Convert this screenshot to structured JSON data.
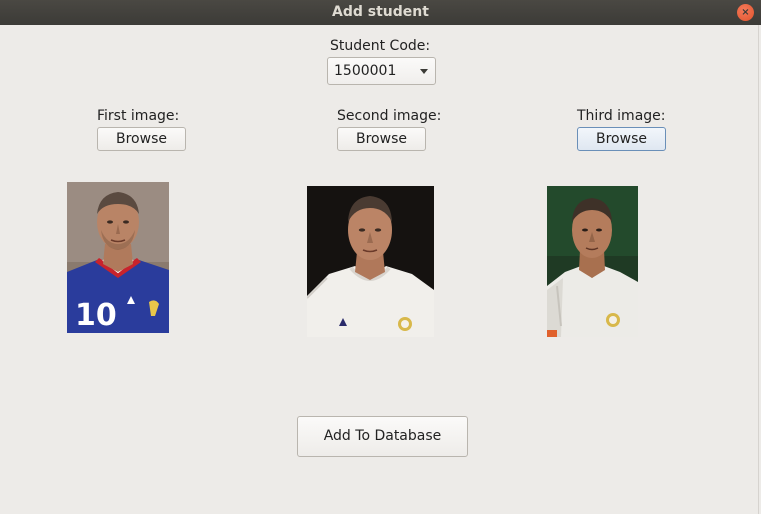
{
  "window": {
    "title": "Add student",
    "close_glyph": "×"
  },
  "student_code": {
    "label": "Student Code:",
    "selected": "1500001"
  },
  "images": [
    {
      "label": "First image:",
      "browse_label": "Browse",
      "icon": "photo-player-blue-jersey-10"
    },
    {
      "label": "Second image:",
      "browse_label": "Browse",
      "icon": "photo-player-white-jersey"
    },
    {
      "label": "Third image:",
      "browse_label": "Browse",
      "icon": "photo-player-white-jersey-green-bg"
    }
  ],
  "photo_number": "10",
  "add_button_label": "Add To Database",
  "colors": {
    "titlebar": "#3c3b37",
    "close": "#e2532c",
    "background": "#edebe8",
    "focus": "#6a8fb8"
  }
}
